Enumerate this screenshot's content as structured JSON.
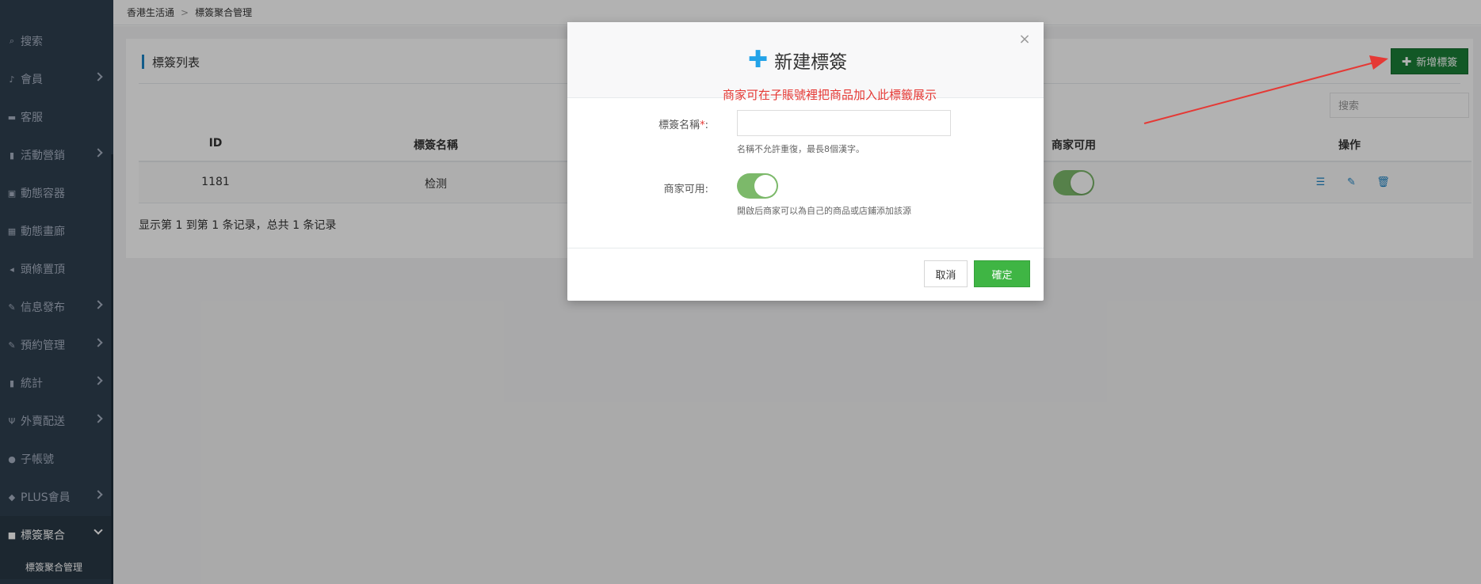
{
  "breadcrumb": {
    "root": "香港生活通",
    "separator": ">",
    "current": "標簽聚合管理"
  },
  "sidebar": {
    "items": [
      {
        "label": "搜索",
        "icon": "search-icon",
        "glyph": "⌕"
      },
      {
        "label": "會員",
        "icon": "bell-icon",
        "glyph": "♪"
      },
      {
        "label": "客服",
        "icon": "chat-icon",
        "glyph": "▬"
      },
      {
        "label": "活動營銷",
        "icon": "bookmark-icon",
        "glyph": "▮"
      },
      {
        "label": "動態容器",
        "icon": "inbox-icon",
        "glyph": "▣"
      },
      {
        "label": "動態畫廊",
        "icon": "image-icon",
        "glyph": "▦"
      },
      {
        "label": "頭條置頂",
        "icon": "megaphone-icon",
        "glyph": "◂"
      },
      {
        "label": "信息發布",
        "icon": "edit-icon",
        "glyph": "✎"
      },
      {
        "label": "預約管理",
        "icon": "edit-icon",
        "glyph": "✎"
      },
      {
        "label": "統計",
        "icon": "bar-chart-icon",
        "glyph": "▮"
      },
      {
        "label": "外賣配送",
        "icon": "cutlery-icon",
        "glyph": "Ψ"
      },
      {
        "label": "子帳號",
        "icon": "user-icon",
        "glyph": "●"
      },
      {
        "label": "PLUS會員",
        "icon": "diamond-icon",
        "glyph": "◆"
      },
      {
        "label": "標簽聚合",
        "icon": "square-icon",
        "glyph": "■"
      }
    ],
    "sub_item": "標簽聚合管理"
  },
  "panel": {
    "title": "標簽列表",
    "add_button": "新增標簽",
    "search_placeholder": "搜索"
  },
  "table": {
    "headers": {
      "id": "ID",
      "name": "標簽名稱",
      "merchant": "商家可用",
      "ops": "操作"
    },
    "rows": [
      {
        "id": "1181",
        "name": "检测"
      }
    ],
    "footer": "显示第 1 到第 1 条记录，总共 1 条记录"
  },
  "modal": {
    "title": "新建標簽",
    "annotation": "商家可在子賬號裡把商品加入此標籤展示",
    "name_label": "標簽名稱",
    "required_mark": "*",
    "colon": ":",
    "name_hint": "名稱不允許重復，最長8個漢字。",
    "merchant_label": "商家可用:",
    "merchant_hint": "開啟后商家可以為自己的商品或店鋪添加該源",
    "cancel": "取消",
    "ok": "確定",
    "close": "×"
  },
  "colors": {
    "primary": "#1c84c6",
    "success": "#3fb544",
    "add_button": "#1a7f37",
    "annotation": "#e53935",
    "sidebar": "#2f4050"
  }
}
